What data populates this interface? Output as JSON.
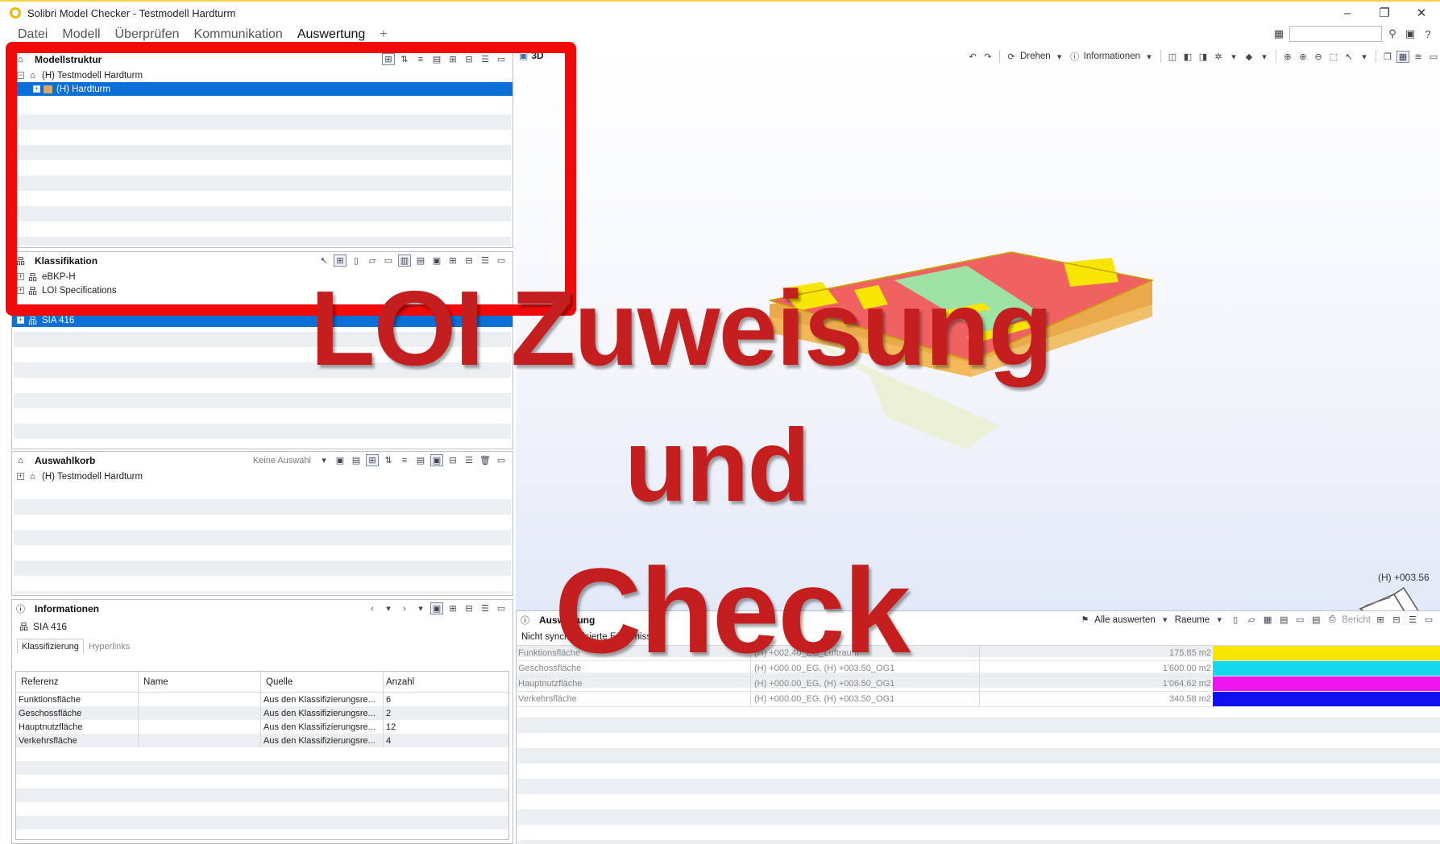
{
  "window": {
    "title": "Solibri Model Checker - Testmodell Hardturm",
    "controls": {
      "minimize": "–",
      "restore": "❐",
      "close": "✕"
    }
  },
  "menu": {
    "items": [
      "Datei",
      "Modell",
      "Überprüfen",
      "Kommunikation",
      "Auswertung"
    ],
    "active": "Auswertung",
    "add": "+"
  },
  "modellstruktur": {
    "title": "Modellstruktur",
    "tree": [
      {
        "label": "(H) Testmodell Hardturm",
        "selected": false
      },
      {
        "label": "(H) Hardturm",
        "selected": true
      }
    ]
  },
  "klassifikation": {
    "title": "Klassifikation",
    "tree": [
      {
        "label": "eBKP-H",
        "selected": false
      },
      {
        "label": "LOI Specifications",
        "selected": false
      },
      {
        "label": "SIA 416",
        "selected": true
      }
    ]
  },
  "auswahlkorb": {
    "title": "Auswahlkorb",
    "selection_label": "Keine Auswahl",
    "tree": [
      {
        "label": "(H) Testmodell Hardturm"
      }
    ]
  },
  "informationen": {
    "title": "Informationen",
    "subject": "SIA 416",
    "tabs": [
      "Klassifizierung",
      "Hyperlinks"
    ],
    "columns": [
      "Referenz",
      "Name",
      "Quelle",
      "Anzahl"
    ],
    "rows": [
      {
        "referenz": "Funktionsfläche",
        "name": "",
        "quelle": "Aus den Klassifizierungsre...",
        "anzahl": "6"
      },
      {
        "referenz": "Geschossfläche",
        "name": "",
        "quelle": "Aus den Klassifizierungsre...",
        "anzahl": "2"
      },
      {
        "referenz": "Hauptnutzfläche",
        "name": "",
        "quelle": "Aus den Klassifizierungsre...",
        "anzahl": "12"
      },
      {
        "referenz": "Verkehrsfläche",
        "name": "",
        "quelle": "Aus den Klassifizierungsre...",
        "anzahl": "4"
      }
    ]
  },
  "view3d": {
    "label": "3D",
    "toolbar": {
      "rotate": "Drehen",
      "info": "Informationen"
    },
    "elevation": "(H) +003.56"
  },
  "auswertung": {
    "title": "Auswertung",
    "subtitle": "Nicht synchronisierte Ergebnisse",
    "toolbar": {
      "evaluate_all": "Alle auswerten",
      "rooms": "Raeume",
      "report": "Bericht"
    },
    "rows": [
      {
        "name": "Funktionsfläche",
        "floors": "(H) +002.40_EG_Luftraum",
        "area": "175.85 m2",
        "color": "#f7e600"
      },
      {
        "name": "Geschossfläche",
        "floors": "(H) +000.00_EG, (H) +003.50_OG1",
        "area": "1'600.00 m2",
        "color": "#14d8ec"
      },
      {
        "name": "Hauptnutzfläche",
        "floors": "(H) +000.00_EG, (H) +003.50_OG1",
        "area": "1'064.62 m2",
        "color": "#ee16ec"
      },
      {
        "name": "Verkehrsfläche",
        "floors": "(H) +000.00_EG, (H) +003.50_OG1",
        "area": "340.58 m2",
        "color": "#1010ee"
      }
    ]
  },
  "overlay": {
    "line1": "LOI Zuweisung",
    "line2": "und",
    "line3": "Check",
    "text_color": "#c41e1e",
    "frame_color": "#f00a0a"
  }
}
